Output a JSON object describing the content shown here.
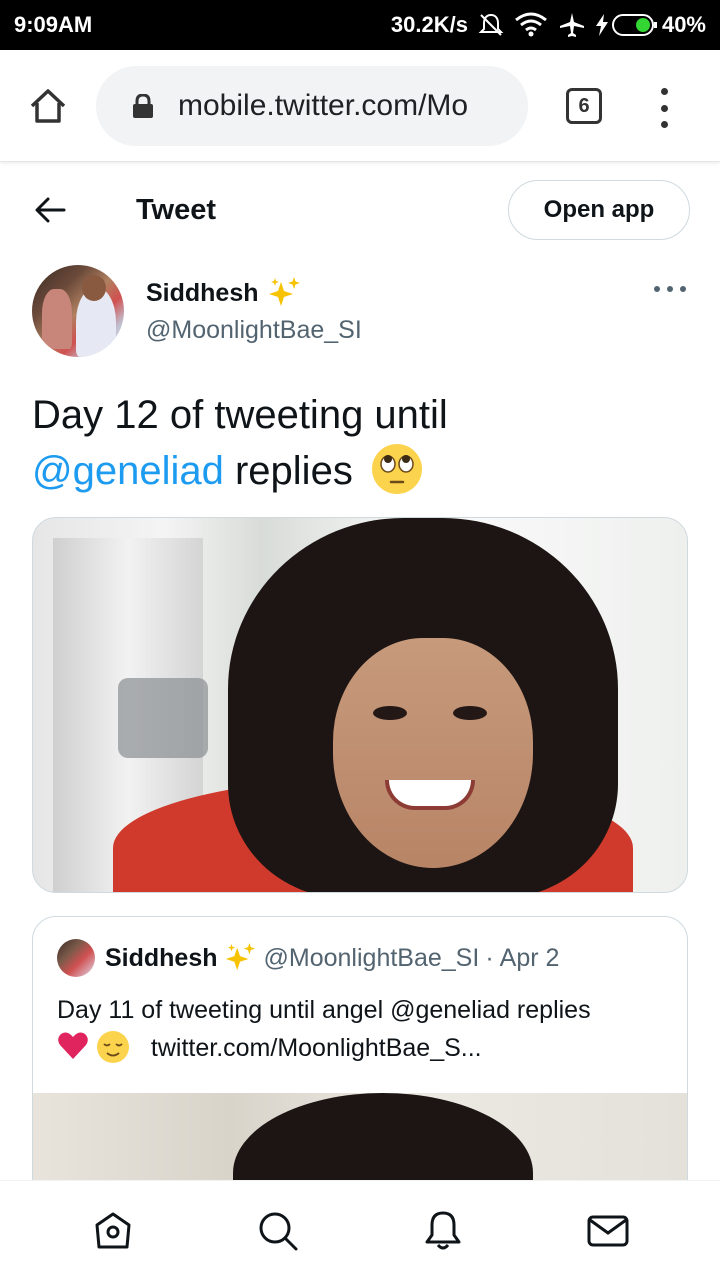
{
  "status_bar": {
    "time": "9:09AM",
    "network_speed": "30.2K/s",
    "battery": "40%",
    "icons": [
      "bell-muted-icon",
      "wifi-icon",
      "airplane-icon",
      "charging-icon",
      "battery-icon"
    ]
  },
  "browser": {
    "url": "mobile.twitter.com/Mo",
    "tab_count": "6",
    "icons": [
      "home-icon",
      "lock-icon",
      "more-vert-icon"
    ]
  },
  "header": {
    "title": "Tweet",
    "open_app_label": "Open app",
    "back_icon": "back-arrow-icon"
  },
  "tweet": {
    "display_name": "Siddhesh",
    "handle": "@MoonlightBae_SI",
    "text_part1": "Day 12 of tweeting until",
    "mention": "@geneliad",
    "text_part2": "replies",
    "emoji": "face-with-rolling-eyes"
  },
  "quote": {
    "display_name": "Siddhesh",
    "handle": "@MoonlightBae_SI",
    "separator": "·",
    "date": "Apr 2",
    "text": "Day 11 of tweeting until angel @geneliad replies",
    "link": "twitter.com/MoonlightBae_S..."
  },
  "bottom_nav": {
    "items": [
      "home-icon",
      "search-icon",
      "notifications-icon",
      "messages-icon"
    ]
  },
  "colors": {
    "accent": "#1d9bf0",
    "text": "#0f1419",
    "secondary": "#536471",
    "border": "#cfd9de"
  }
}
